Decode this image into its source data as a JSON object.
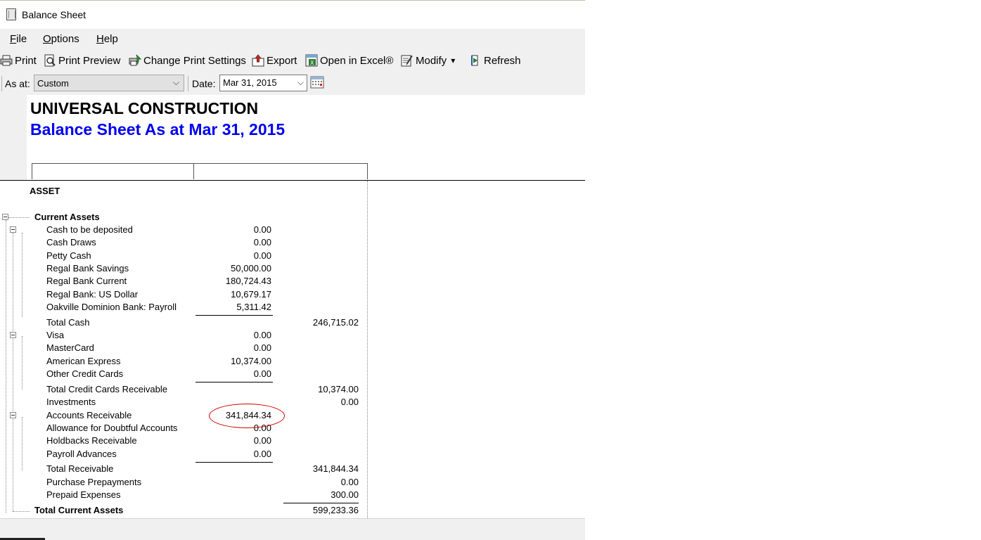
{
  "window": {
    "title": "Balance Sheet"
  },
  "menu": [
    {
      "label_pre": "",
      "label_ul": "F",
      "label_post": "ile"
    },
    {
      "label_pre": "",
      "label_ul": "O",
      "label_post": "ptions"
    },
    {
      "label_pre": "",
      "label_ul": "H",
      "label_post": "elp"
    }
  ],
  "toolbar": {
    "print": "Print",
    "print_preview": "Print Preview",
    "change_print_settings": "Change Print Settings",
    "export": "Export",
    "open_in_excel": "Open in Excel®",
    "modify": "Modify",
    "modify_arrow": "▾",
    "refresh": "Refresh"
  },
  "filter": {
    "as_at_label": "As at:",
    "as_at_value": "Custom",
    "date_label": "Date:",
    "date_value": "Mar 31, 2015",
    "chevron": "⌵"
  },
  "report": {
    "company": "UNIVERSAL CONSTRUCTION",
    "title": "Balance Sheet As at Mar 31, 2015",
    "section": "ASSET",
    "group": "Current Assets",
    "rows": [
      {
        "label": "Cash to be deposited",
        "c1": "0.00",
        "c2": ""
      },
      {
        "label": "Cash Draws",
        "c1": "0.00",
        "c2": ""
      },
      {
        "label": "Petty Cash",
        "c1": "0.00",
        "c2": ""
      },
      {
        "label": "Regal Bank Savings",
        "c1": "50,000.00",
        "c2": ""
      },
      {
        "label": "Regal Bank Current",
        "c1": "180,724.43",
        "c2": ""
      },
      {
        "label": "Regal Bank: US Dollar",
        "c1": "10,679.17",
        "c2": ""
      },
      {
        "label": "Oakville Dominion Bank: Payroll",
        "c1": "5,311.42",
        "c2": ""
      },
      {
        "label": "Total Cash",
        "c1": "",
        "c2": "246,715.02"
      },
      {
        "label": "Visa",
        "c1": "0.00",
        "c2": ""
      },
      {
        "label": "MasterCard",
        "c1": "0.00",
        "c2": ""
      },
      {
        "label": "American Express",
        "c1": "10,374.00",
        "c2": ""
      },
      {
        "label": "Other Credit Cards",
        "c1": "0.00",
        "c2": ""
      },
      {
        "label": "Total Credit Cards Receivable",
        "c1": "",
        "c2": "10,374.00"
      },
      {
        "label": "Investments",
        "c1": "",
        "c2": "0.00"
      },
      {
        "label": "Accounts Receivable",
        "c1": "341,844.34",
        "c2": ""
      },
      {
        "label": "Allowance for Doubtful Accounts",
        "c1": "0.00",
        "c2": ""
      },
      {
        "label": "Holdbacks Receivable",
        "c1": "0.00",
        "c2": ""
      },
      {
        "label": "Payroll Advances",
        "c1": "0.00",
        "c2": ""
      },
      {
        "label": "Total Receivable",
        "c1": "",
        "c2": "341,844.34"
      },
      {
        "label": "Purchase Prepayments",
        "c1": "",
        "c2": "0.00"
      },
      {
        "label": "Prepaid Expenses",
        "c1": "",
        "c2": "300.00"
      }
    ],
    "total_label": "Total Current Assets",
    "total_value": "599,233.36"
  },
  "colors": {
    "title_blue": "#0000ee",
    "annotation_red": "#d10000"
  }
}
